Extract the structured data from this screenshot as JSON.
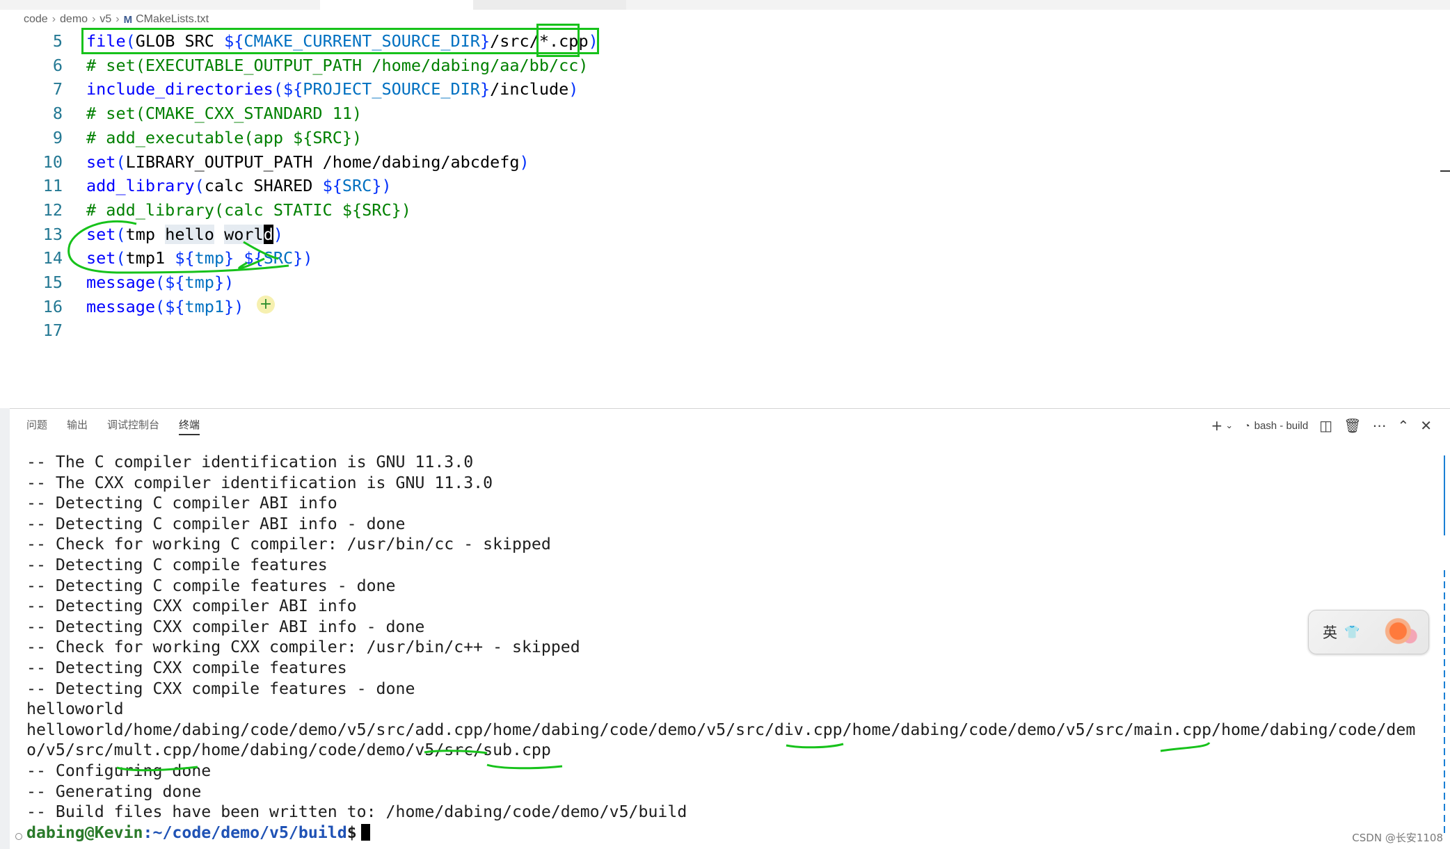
{
  "breadcrumb": {
    "items": [
      "code",
      "demo",
      "v5"
    ],
    "file_icon": "M",
    "file": "CMakeLists.txt"
  },
  "editor": {
    "lines": [
      {
        "num": "5",
        "tokens": [
          [
            "kw",
            "file"
          ],
          [
            "paren",
            "("
          ],
          [
            "txt",
            "GLOB SRC "
          ],
          [
            "brace",
            "${"
          ],
          [
            "var",
            "CMAKE_CURRENT_SOURCE_DIR"
          ],
          [
            "brace",
            "}"
          ],
          [
            "txt",
            "/src/"
          ],
          [
            "txt",
            "*.cpp"
          ],
          [
            "paren",
            ")"
          ]
        ]
      },
      {
        "num": "6",
        "tokens": [
          [
            "cmt",
            "# set(EXECUTABLE_OUTPUT_PATH /home/dabing/aa/bb/cc)"
          ]
        ]
      },
      {
        "num": "7",
        "tokens": [
          [
            "kw",
            "include_directories"
          ],
          [
            "paren",
            "("
          ],
          [
            "brace",
            "${"
          ],
          [
            "var",
            "PROJECT_SOURCE_DIR"
          ],
          [
            "brace",
            "}"
          ],
          [
            "txt",
            "/include"
          ],
          [
            "paren",
            ")"
          ]
        ]
      },
      {
        "num": "8",
        "tokens": [
          [
            "cmt",
            "# set(CMAKE_CXX_STANDARD 11)"
          ]
        ]
      },
      {
        "num": "9",
        "tokens": [
          [
            "cmt",
            "# add_executable(app ${SRC})"
          ]
        ]
      },
      {
        "num": "10",
        "tokens": [
          [
            "kw",
            "set"
          ],
          [
            "paren",
            "("
          ],
          [
            "txt",
            "LIBRARY_OUTPUT_PATH /home/dabing/abcdefg"
          ],
          [
            "paren",
            ")"
          ]
        ]
      },
      {
        "num": "11",
        "tokens": [
          [
            "kw",
            "add_library"
          ],
          [
            "paren",
            "("
          ],
          [
            "txt",
            "calc SHARED "
          ],
          [
            "brace",
            "${"
          ],
          [
            "var",
            "SRC"
          ],
          [
            "brace",
            "}"
          ],
          [
            "paren",
            ")"
          ]
        ]
      },
      {
        "num": "12",
        "tokens": [
          [
            "cmt",
            "# add_library(calc STATIC ${SRC})"
          ]
        ]
      },
      {
        "num": "13",
        "tokens": [
          [
            "kw",
            "set"
          ],
          [
            "paren",
            "("
          ],
          [
            "txt",
            "tmp "
          ],
          [
            "sel",
            "hello"
          ],
          [
            "txt",
            " "
          ],
          [
            "sel",
            "worl"
          ],
          [
            "cursor",
            "d"
          ],
          [
            "paren",
            ")"
          ]
        ]
      },
      {
        "num": "14",
        "tokens": [
          [
            "kw",
            "set"
          ],
          [
            "paren",
            "("
          ],
          [
            "txt",
            "tmp1 "
          ],
          [
            "brace",
            "${"
          ],
          [
            "var",
            "tmp"
          ],
          [
            "brace",
            "}"
          ],
          [
            "txt",
            " "
          ],
          [
            "brace",
            "${"
          ],
          [
            "var",
            "SRC"
          ],
          [
            "brace",
            "}"
          ],
          [
            "paren",
            ")"
          ]
        ]
      },
      {
        "num": "15",
        "tokens": [
          [
            "kw",
            "message"
          ],
          [
            "paren",
            "("
          ],
          [
            "brace",
            "${"
          ],
          [
            "var",
            "tmp"
          ],
          [
            "brace",
            "}"
          ],
          [
            "paren",
            ")"
          ]
        ]
      },
      {
        "num": "16",
        "tokens": [
          [
            "kw",
            "message"
          ],
          [
            "paren",
            "("
          ],
          [
            "brace",
            "${"
          ],
          [
            "var",
            "tmp1"
          ],
          [
            "brace",
            "}"
          ],
          [
            "paren",
            ")"
          ]
        ]
      },
      {
        "num": "17",
        "tokens": []
      }
    ],
    "hint_badge": "+"
  },
  "panel": {
    "tabs": [
      "问题",
      "输出",
      "调试控制台",
      "终端"
    ],
    "active_tab": "终端",
    "terminal_name": "bash - build",
    "icons": [
      "plus-icon",
      "chevron-down-icon",
      "split-icon",
      "trash-icon",
      "more-icon",
      "chevron-up-icon",
      "close-icon"
    ]
  },
  "terminal": {
    "lines": [
      "-- The C compiler identification is GNU 11.3.0",
      "-- The CXX compiler identification is GNU 11.3.0",
      "-- Detecting C compiler ABI info",
      "-- Detecting C compiler ABI info - done",
      "-- Check for working C compiler: /usr/bin/cc - skipped",
      "-- Detecting C compile features",
      "-- Detecting C compile features - done",
      "-- Detecting CXX compiler ABI info",
      "-- Detecting CXX compiler ABI info - done",
      "-- Check for working CXX compiler: /usr/bin/c++ - skipped",
      "-- Detecting CXX compile features",
      "-- Detecting CXX compile features - done",
      "helloworld",
      "helloworld/home/dabing/code/demo/v5/src/add.cpp/home/dabing/code/demo/v5/src/div.cpp/home/dabing/code/demo/v5/src/main.cpp/home/dabing/code/dem",
      "o/v5/src/mult.cpp/home/dabing/code/demo/v5/src/sub.cpp",
      "-- Configuring done",
      "-- Generating done",
      "-- Build files have been written to: /home/dabing/code/demo/v5/build"
    ],
    "prompt_user": "dabing@Kevin",
    "prompt_path": ":~/code/demo/v5/build",
    "prompt_symbol": "$"
  },
  "ime": {
    "lang": "英",
    "icon": "shirt-icon"
  },
  "watermark": "CSDN @长安1108",
  "colors": {
    "annotation": "#17c21b",
    "keyword": "#0000ff",
    "variable": "#0070c1",
    "comment": "#008000",
    "line_number": "#237893"
  }
}
